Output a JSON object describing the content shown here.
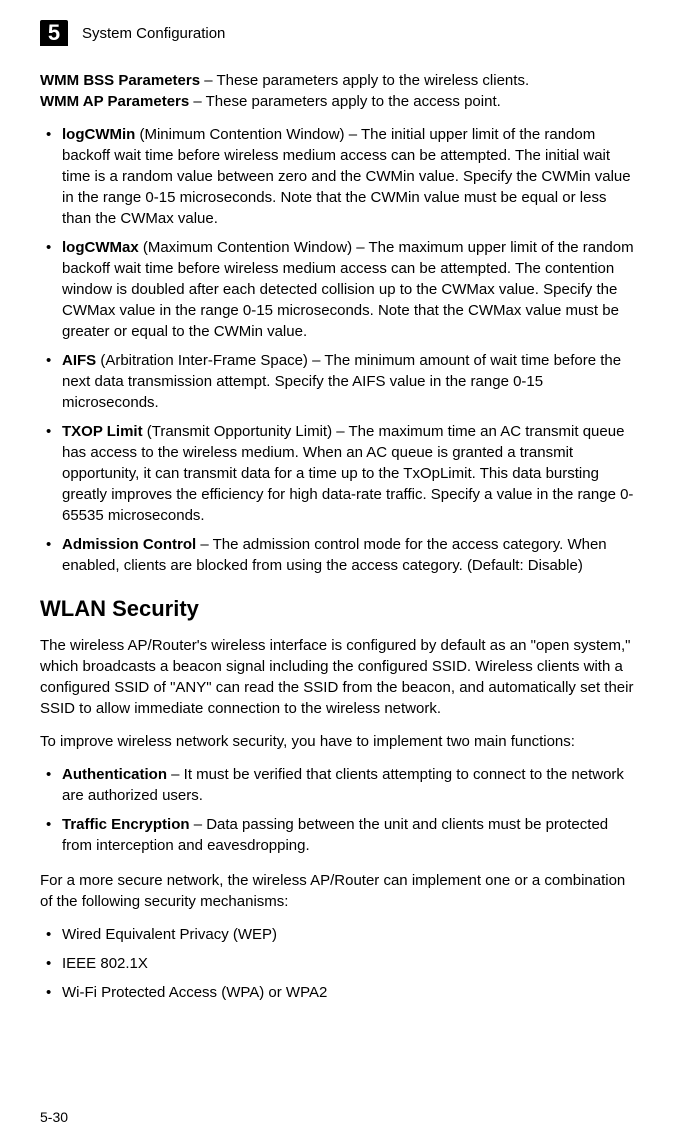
{
  "header": {
    "chapter_number": "5",
    "chapter_title": "System Configuration"
  },
  "intro": {
    "line1_bold": "WMM BSS Parameters",
    "line1_rest": " – These parameters apply to the wireless clients.",
    "line2_bold": "WMM AP Parameters",
    "line2_rest": " – These parameters apply to the access point."
  },
  "wmm_params": [
    {
      "term": "logCWMin",
      "paren": " (Minimum Contention Window) – ",
      "desc": "The initial upper limit of the random backoff wait time before wireless medium access can be attempted. The initial wait time is a random value between zero and the CWMin value. Specify the CWMin value in the range 0-15 microseconds. Note that the CWMin value must be equal or less than the CWMax value."
    },
    {
      "term": "logCWMax",
      "paren": " (Maximum Contention Window) – ",
      "desc": "The maximum upper limit of the random backoff wait time before wireless medium access can be attempted. The contention window is doubled after each detected collision up to the CWMax value. Specify the CWMax value in the range 0-15 microseconds. Note that the CWMax value must be greater or equal to the CWMin value."
    },
    {
      "term": "AIFS",
      "paren": " (Arbitration Inter-Frame Space) – ",
      "desc": "The minimum amount of wait time before the next data transmission attempt. Specify the AIFS value in the range 0-15 microseconds."
    },
    {
      "term": "TXOP Limit",
      "paren": " (Transmit Opportunity Limit) – ",
      "desc": "The maximum time an AC transmit queue has access to the wireless medium. When an AC queue is granted a transmit opportunity, it can transmit data for a time up to the TxOpLimit. This data bursting greatly improves the efficiency for high data-rate traffic. Specify a value in the range 0-65535 microseconds."
    },
    {
      "term": "Admission Control",
      "paren": " – ",
      "desc": "The admission control mode for the access category. When enabled, clients are blocked from using the access category. (Default: Disable)"
    }
  ],
  "wlan": {
    "heading": "WLAN Security",
    "para1": "The wireless AP/Router's wireless interface is configured by default as an \"open system,\" which broadcasts a beacon signal including the configured SSID. Wireless clients with a configured SSID of \"ANY\" can read the SSID from the beacon, and automatically set their SSID to allow immediate connection to the wireless network.",
    "para2": "To improve wireless network security, you have to implement two main functions:",
    "funcs": [
      {
        "term": "Authentication",
        "rest": " – It must be verified that clients attempting to connect to the network are authorized users."
      },
      {
        "term": "Traffic Encryption",
        "rest": " – Data passing between the unit and clients must be protected from interception and eavesdropping."
      }
    ],
    "para3": "For a more secure network, the wireless AP/Router can implement one or a combination of the following security mechanisms:",
    "mechanisms": [
      "Wired Equivalent Privacy (WEP)",
      "IEEE 802.1X",
      "Wi-Fi Protected Access (WPA) or WPA2"
    ]
  },
  "footer": {
    "page_number": "5-30"
  }
}
